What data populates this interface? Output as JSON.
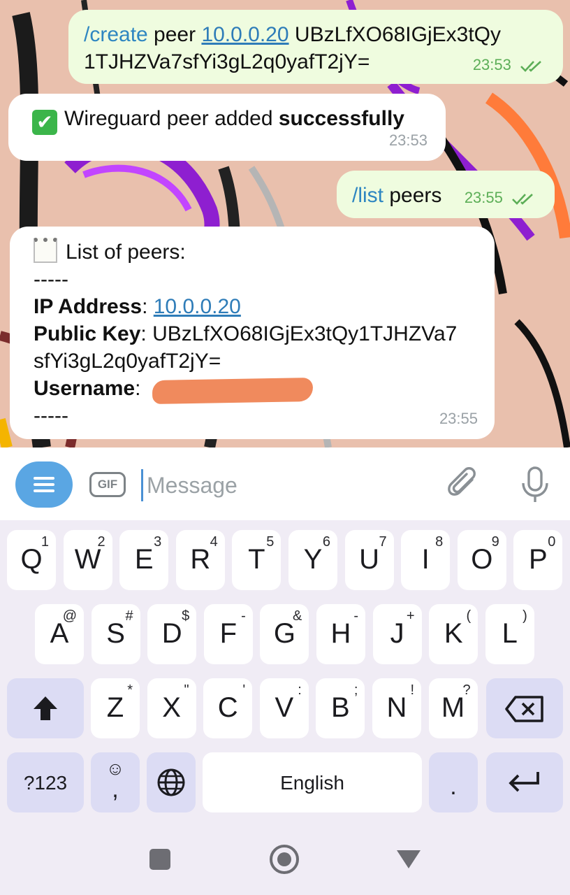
{
  "messages": [
    {
      "direction": "outgoing",
      "command": "/create",
      "text1": " peer ",
      "link": "10.0.0.20",
      "text2": " UBzLfXO68IGjEx3tQy",
      "line2": "1TJHZVa7sfYi3gL2q0yafT2jY=",
      "time": "23:53",
      "status": "read"
    },
    {
      "direction": "incoming",
      "emoji": "✅",
      "text": "Wireguard peer added ",
      "bold": "successfully",
      "time": "23:53"
    },
    {
      "direction": "outgoing",
      "command": "/list",
      "text": " peers",
      "time": "23:55",
      "status": "read"
    },
    {
      "direction": "incoming",
      "emoji": "🗒️",
      "title": "List of peers:",
      "separator": "-----",
      "ip_label": "IP Address",
      "ip_value": "10.0.0.20",
      "key_label": "Public Key",
      "key_value_line1": "UBzLfXO68IGjEx3tQy1TJHZVa7",
      "key_value_line2": "sfYi3gL2q0yafT2jY=",
      "user_label": "Username",
      "user_value": "[redacted]",
      "separator_end": "-----",
      "time": "23:55"
    }
  ],
  "composer": {
    "gif_label": "GIF",
    "placeholder": "Message"
  },
  "keyboard": {
    "row1": [
      {
        "k": "Q",
        "s": "1"
      },
      {
        "k": "W",
        "s": "2"
      },
      {
        "k": "E",
        "s": "3"
      },
      {
        "k": "R",
        "s": "4"
      },
      {
        "k": "T",
        "s": "5"
      },
      {
        "k": "Y",
        "s": "6"
      },
      {
        "k": "U",
        "s": "7"
      },
      {
        "k": "I",
        "s": "8"
      },
      {
        "k": "O",
        "s": "9"
      },
      {
        "k": "P",
        "s": "0"
      }
    ],
    "row2": [
      {
        "k": "A",
        "s": "@"
      },
      {
        "k": "S",
        "s": "#"
      },
      {
        "k": "D",
        "s": "$"
      },
      {
        "k": "F",
        "s": "-"
      },
      {
        "k": "G",
        "s": "&"
      },
      {
        "k": "H",
        "s": "-"
      },
      {
        "k": "J",
        "s": "+"
      },
      {
        "k": "K",
        "s": "("
      },
      {
        "k": "L",
        "s": ")"
      }
    ],
    "row3": [
      {
        "k": "Z",
        "s": "*"
      },
      {
        "k": "X",
        "s": "\""
      },
      {
        "k": "C",
        "s": "'"
      },
      {
        "k": "V",
        "s": ":"
      },
      {
        "k": "B",
        "s": ";"
      },
      {
        "k": "N",
        "s": "!"
      },
      {
        "k": "M",
        "s": "?"
      }
    ],
    "symbols_label": "?123",
    "comma": ",",
    "space_label": "English",
    "period": "."
  },
  "colors": {
    "outgoing_bubble": "#effcdf",
    "incoming_bubble": "#ffffff",
    "link": "#2e7cb8",
    "accent": "#5aa6e3",
    "redaction": "#f08a5d"
  }
}
